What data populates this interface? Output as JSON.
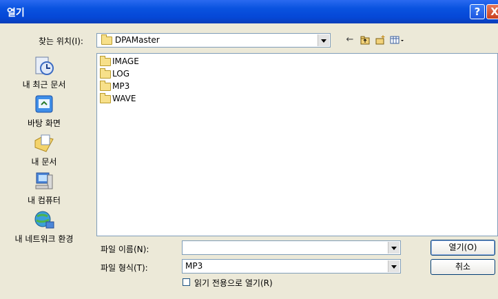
{
  "window": {
    "title": "열기",
    "help_label": "?",
    "close_label": "X"
  },
  "look_in": {
    "label": "찾는 위치(I):",
    "value": "DPAMaster"
  },
  "toolbar": {
    "icons": [
      "back-arrow-icon",
      "up-folder-icon",
      "new-folder-icon",
      "view-menu-icon"
    ]
  },
  "places": [
    {
      "label": "내 최근 문서",
      "icon": "recent-documents-icon"
    },
    {
      "label": "바탕 화면",
      "icon": "desktop-icon"
    },
    {
      "label": "내 문서",
      "icon": "my-documents-icon"
    },
    {
      "label": "내 컴퓨터",
      "icon": "my-computer-icon"
    },
    {
      "label": "내 네트워크 환경",
      "icon": "network-icon"
    }
  ],
  "files": [
    "IMAGE",
    "LOG",
    "MP3",
    "WAVE"
  ],
  "filename": {
    "label": "파일 이름(N):",
    "value": ""
  },
  "filetype": {
    "label": "파일 형식(T):",
    "value": "MP3"
  },
  "readonly": {
    "label": "읽기 전용으로 열기(R)",
    "checked": false
  },
  "buttons": {
    "open": "열기(O)",
    "cancel": "취소"
  }
}
